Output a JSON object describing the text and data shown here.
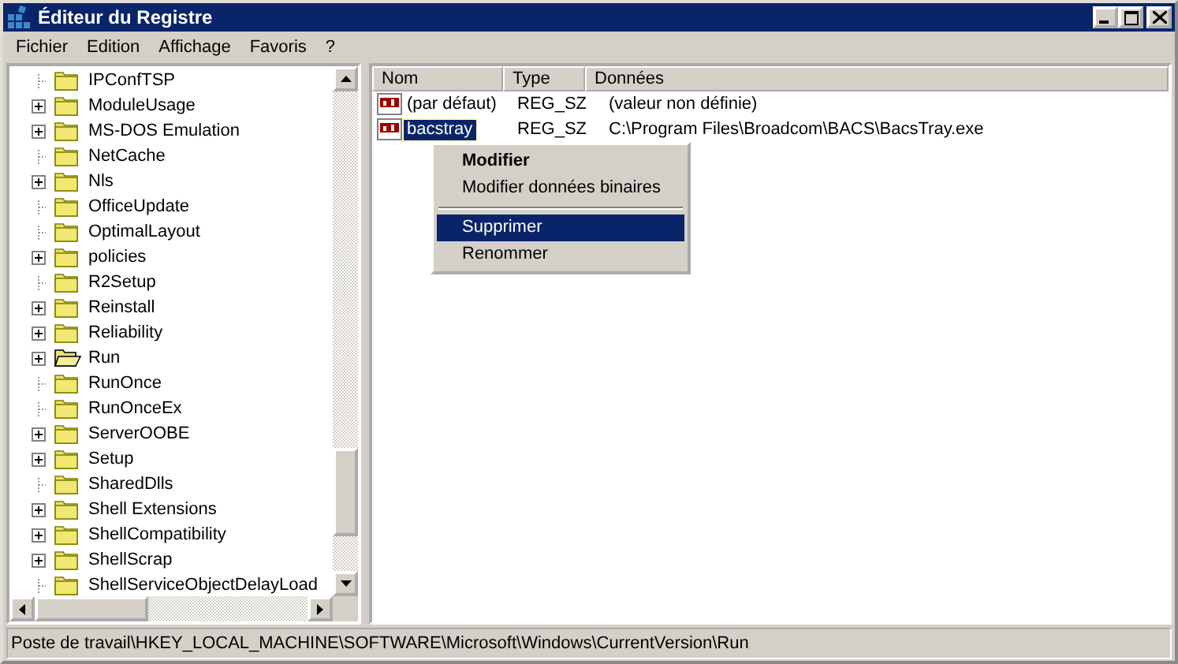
{
  "window": {
    "title": "Éditeur du Registre"
  },
  "menu": [
    "Fichier",
    "Edition",
    "Affichage",
    "Favoris",
    "?"
  ],
  "tree": {
    "items": [
      {
        "label": "IPConfTSP",
        "expandable": false,
        "open": false
      },
      {
        "label": "ModuleUsage",
        "expandable": true,
        "open": false
      },
      {
        "label": "MS-DOS Emulation",
        "expandable": true,
        "open": false
      },
      {
        "label": "NetCache",
        "expandable": false,
        "open": false
      },
      {
        "label": "Nls",
        "expandable": true,
        "open": false
      },
      {
        "label": "OfficeUpdate",
        "expandable": false,
        "open": false
      },
      {
        "label": "OptimalLayout",
        "expandable": false,
        "open": false
      },
      {
        "label": "policies",
        "expandable": true,
        "open": false
      },
      {
        "label": "R2Setup",
        "expandable": false,
        "open": false
      },
      {
        "label": "Reinstall",
        "expandable": true,
        "open": false
      },
      {
        "label": "Reliability",
        "expandable": true,
        "open": false
      },
      {
        "label": "Run",
        "expandable": true,
        "open": true
      },
      {
        "label": "RunOnce",
        "expandable": false,
        "open": false
      },
      {
        "label": "RunOnceEx",
        "expandable": false,
        "open": false
      },
      {
        "label": "ServerOOBE",
        "expandable": true,
        "open": false
      },
      {
        "label": "Setup",
        "expandable": true,
        "open": false
      },
      {
        "label": "SharedDlls",
        "expandable": false,
        "open": false
      },
      {
        "label": "Shell Extensions",
        "expandable": true,
        "open": false
      },
      {
        "label": "ShellCompatibility",
        "expandable": true,
        "open": false
      },
      {
        "label": "ShellScrap",
        "expandable": true,
        "open": false
      },
      {
        "label": "ShellServiceObjectDelayLoad",
        "expandable": false,
        "open": false
      }
    ]
  },
  "values": {
    "columns": [
      "Nom",
      "Type",
      "Données"
    ],
    "rows": [
      {
        "name": "(par défaut)",
        "type": "REG_SZ",
        "data": "(valeur non définie)",
        "selected": false
      },
      {
        "name": "bacstray",
        "type": "REG_SZ",
        "data": "C:\\Program Files\\Broadcom\\BACS\\BacsTray.exe",
        "selected": true
      }
    ]
  },
  "context_menu": {
    "items": [
      {
        "kind": "item",
        "label": "Modifier",
        "default": true,
        "selected": false
      },
      {
        "kind": "item",
        "label": "Modifier données binaires",
        "default": false,
        "selected": false
      },
      {
        "kind": "separator"
      },
      {
        "kind": "item",
        "label": "Supprimer",
        "default": false,
        "selected": true
      },
      {
        "kind": "item",
        "label": "Renommer",
        "default": false,
        "selected": false
      }
    ]
  },
  "status_bar": "Poste de travail\\HKEY_LOCAL_MACHINE\\SOFTWARE\\Microsoft\\Windows\\CurrentVersion\\Run"
}
